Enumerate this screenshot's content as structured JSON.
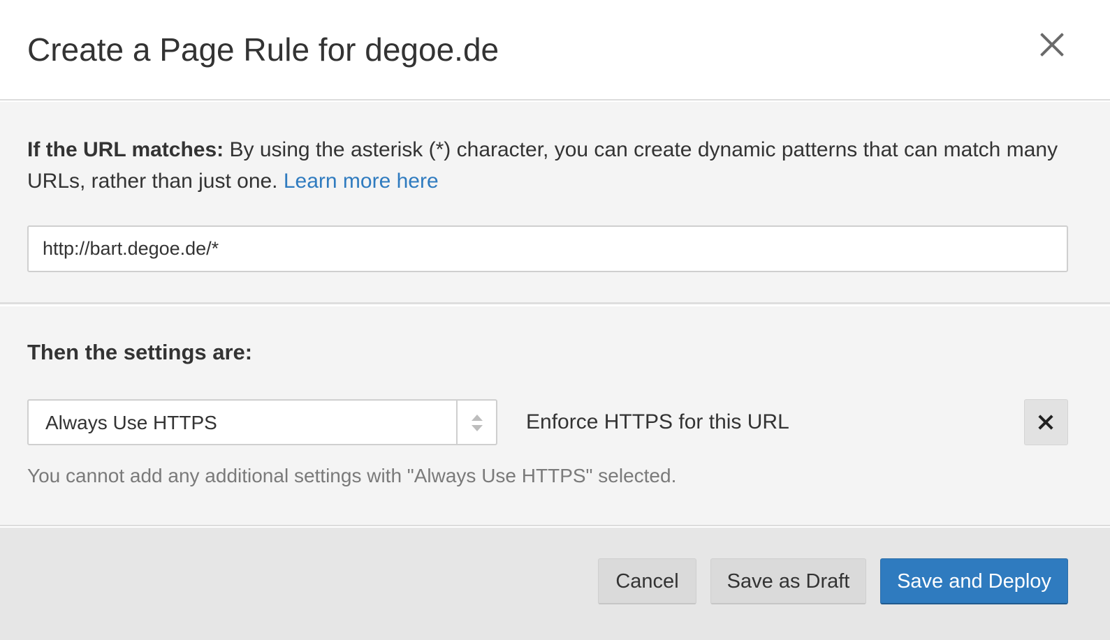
{
  "dialog": {
    "title": "Create a Page Rule for degoe.de",
    "close_icon": "close-icon"
  },
  "url_match": {
    "label": "If the URL matches:",
    "description": " By using the asterisk (*) character, you can create dynamic patterns that can match many URLs, rather than just one. ",
    "learn_more": "Learn more here",
    "url_value": "http://bart.degoe.de/*"
  },
  "settings": {
    "heading": "Then the settings are:",
    "selected_setting": "Always Use HTTPS",
    "setting_description": "Enforce HTTPS for this URL",
    "remove_icon": "close-icon",
    "note": "You cannot add any additional settings with \"Always Use HTTPS\" selected."
  },
  "footer": {
    "cancel_label": "Cancel",
    "draft_label": "Save as Draft",
    "deploy_label": "Save and Deploy"
  },
  "colors": {
    "accent": "#2f7bbf",
    "section_bg": "#f4f4f4",
    "footer_bg": "#e6e6e6"
  }
}
